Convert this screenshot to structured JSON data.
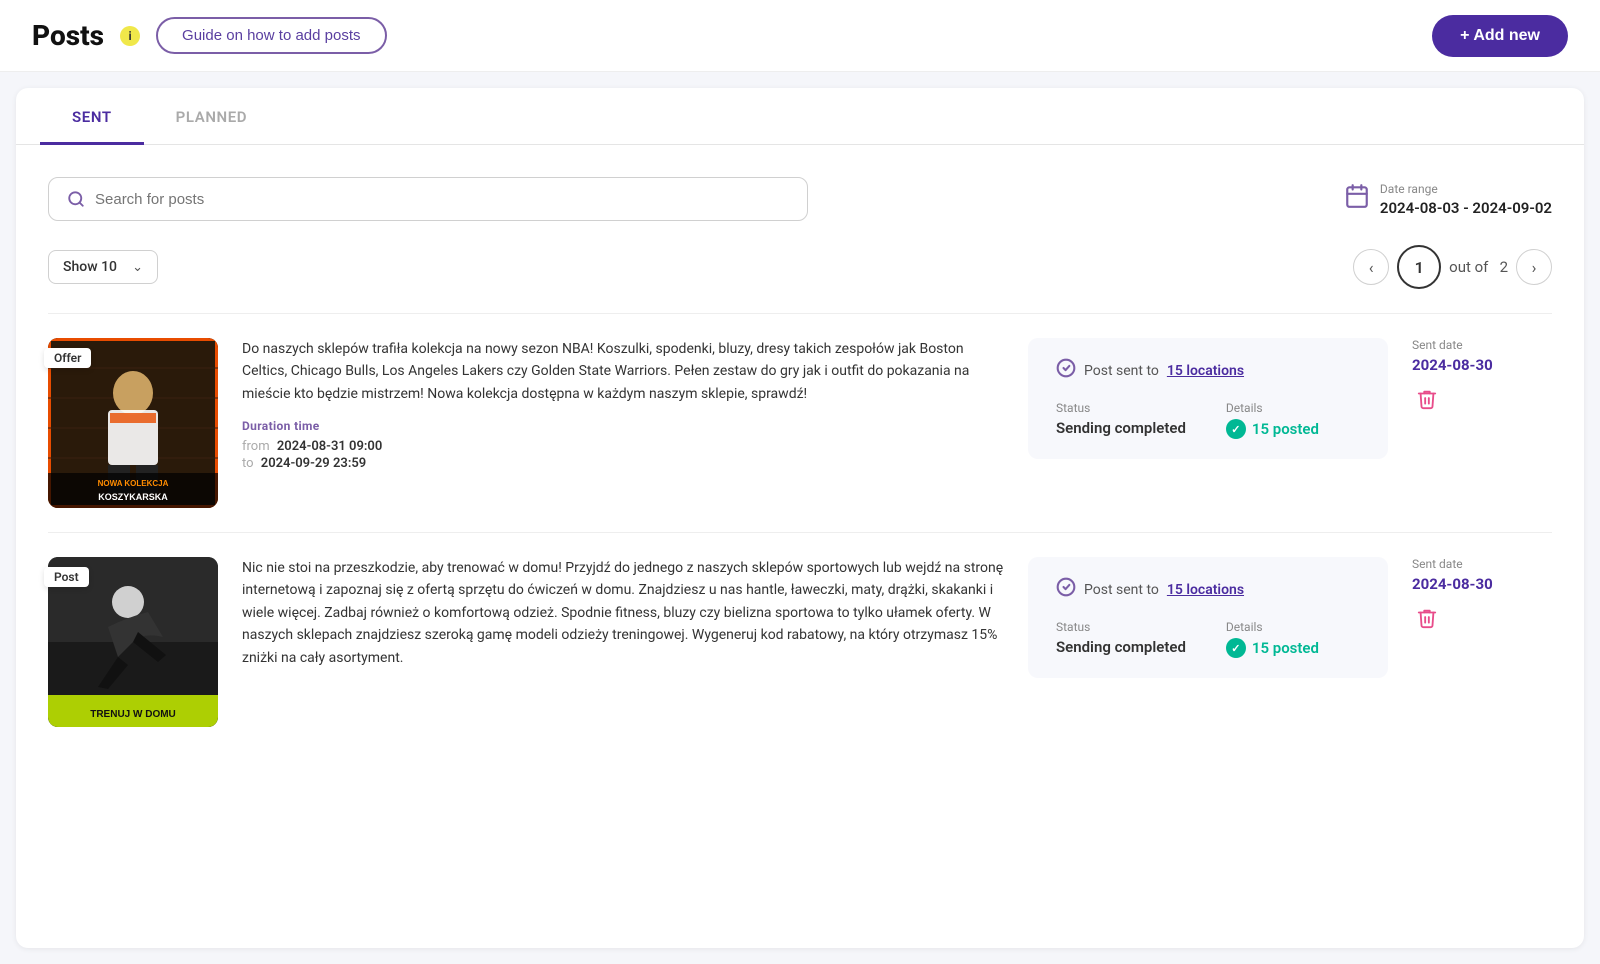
{
  "header": {
    "title": "Posts",
    "info_icon": "i",
    "guide_btn": "Guide on how to add posts",
    "add_new_btn": "+ Add new"
  },
  "tabs": [
    {
      "id": "sent",
      "label": "SENT",
      "active": true
    },
    {
      "id": "planned",
      "label": "PLANNED",
      "active": false
    }
  ],
  "search": {
    "placeholder": "Search for posts"
  },
  "date_range": {
    "label": "Date range",
    "value": "2024-08-03 - 2024-09-02"
  },
  "show_select": {
    "label": "Show 10"
  },
  "pagination": {
    "current": "1",
    "out_of_label": "out of",
    "total": "2"
  },
  "posts": [
    {
      "id": "post-1",
      "type_badge": "Offer",
      "thumbnail_bg": "#2a1a0a",
      "thumbnail_label": "NOWA KOLEKCJA\nKOSZYKARSKA",
      "thumbnail_accent": "#e84c00",
      "text": "Do naszych sklepów trafiła kolekcja na nowy sezon NBA! Koszulki, spodenki, bluzy, dresy takich zespołów jak Boston Celtics, Chicago Bulls, Los Angeles Lakers czy Golden State Warriors. Pełen zestaw do gry jak i outfit do pokazania na mieście kto będzie mistrzem! Nowa kolekcja dostępna w każdym naszym sklepie, sprawdź!",
      "duration_label": "Duration time",
      "from_label": "from",
      "from_val": "2024-08-31 09:00",
      "to_label": "to",
      "to_val": "2024-09-29 23:59",
      "sent_to_text": "Post sent to",
      "locations_link": "15 locations",
      "status_label": "Status",
      "status_value": "Sending completed",
      "details_label": "Details",
      "posted_link": "15 posted",
      "sent_date_label": "Sent date",
      "sent_date_value": "2024-08-30"
    },
    {
      "id": "post-2",
      "type_badge": "Post",
      "thumbnail_bg": "#1a1a1a",
      "thumbnail_label": "TRENUJ W DOMU",
      "thumbnail_accent": "#c8f000",
      "text": "Nic nie stoi na przeszkodzie, aby trenować w domu! Przyjdź do jednego z naszych sklepów sportowych lub wejdź na stronę internetową i zapoznaj się z ofertą sprzętu do ćwiczeń w domu. Znajdziesz u nas hantle, ławeczki, maty, drążki, skakanki i wiele więcej. Zadbaj również o komfortową odzież. Spodnie fitness, bluzy czy bielizna sportowa to tylko ułamek oferty. W naszych sklepach znajdziesz szeroką gamę modeli odzieży treningowej. Wygeneruj kod rabatowy, na który otrzymasz 15% zniżki na cały asortyment.",
      "duration_label": "",
      "from_label": "",
      "from_val": "",
      "to_label": "",
      "to_val": "",
      "sent_to_text": "Post sent to",
      "locations_link": "15 locations",
      "status_label": "Status",
      "status_value": "Sending completed",
      "details_label": "Details",
      "posted_link": "15 posted",
      "sent_date_label": "Sent date",
      "sent_date_value": "2024-08-30"
    }
  ],
  "colors": {
    "primary": "#4b2ca0",
    "accent": "#7b5ea7",
    "success": "#00b894",
    "delete": "#e84c8a",
    "yellow": "#f0e84a"
  }
}
